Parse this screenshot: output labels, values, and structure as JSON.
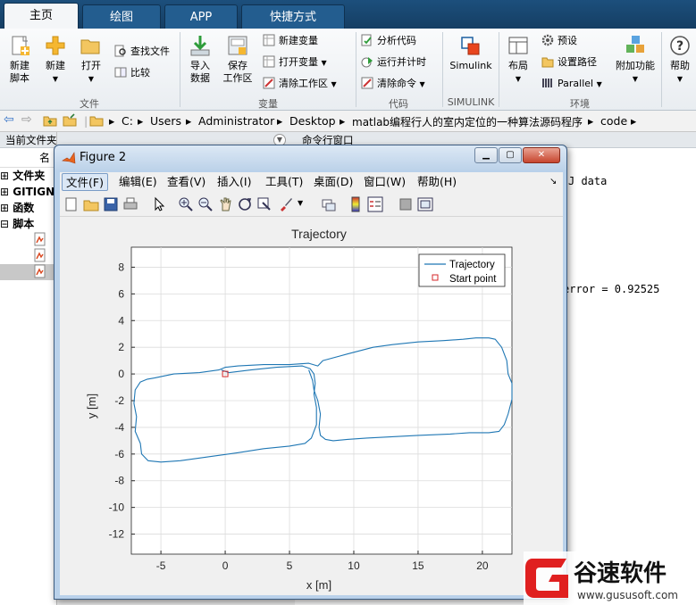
{
  "tabs": [
    {
      "label": "主页",
      "active": true
    },
    {
      "label": "绘图",
      "active": false
    },
    {
      "label": "APP",
      "active": false
    },
    {
      "label": "快捷方式",
      "active": false
    }
  ],
  "ribbon": {
    "file": {
      "new_script": "新建\n脚本",
      "new": "新建",
      "open": "打开",
      "find_files": "查找文件",
      "compare": "比较",
      "group": "文件"
    },
    "variable": {
      "import_data": "导入\n数据",
      "save_workspace": "保存\n工作区",
      "new_variable": "新建变量",
      "open_variable": "打开变量",
      "clear_workspace": "清除工作区",
      "group": "变量"
    },
    "code": {
      "analyze_code": "分析代码",
      "run_and_time": "运行并计时",
      "clear_commands": "清除命令",
      "group": "代码"
    },
    "simulink": {
      "label": "Simulink",
      "group": "SIMULINK"
    },
    "environment": {
      "layout": "布局",
      "preferences": "预设",
      "set_path": "设置路径",
      "parallel": "Parallel",
      "addons": "附加功能",
      "group": "环境"
    },
    "help": {
      "label": "帮助"
    }
  },
  "address": {
    "path": [
      "C:",
      "Users",
      "Administrator",
      "Desktop",
      "matlab编程行人的室内定位的一种算法源码程序",
      "code"
    ]
  },
  "left_panel": {
    "header": "当前文件夹",
    "col_name": "名",
    "items": [
      "文件夹",
      "GITIGN",
      "函数",
      "脚本"
    ]
  },
  "command_window": {
    "header": "命令行窗口",
    "lines": [
      "J data",
      "error = 0.92525"
    ]
  },
  "figure": {
    "title": "Figure 2",
    "menu": [
      "文件(F)",
      "编辑(E)",
      "查看(V)",
      "插入(I)",
      "工具(T)",
      "桌面(D)",
      "窗口(W)",
      "帮助(H)"
    ],
    "toolbar_icons": [
      "new-figure-icon",
      "open-file-icon",
      "save-icon",
      "print-icon",
      "pointer-icon",
      "zoom-in-icon",
      "zoom-out-icon",
      "pan-icon",
      "rotate-icon",
      "data-cursor-icon",
      "brush-icon",
      "link-icon",
      "colorbar-icon",
      "legend-icon",
      "hide-plot-tools-icon",
      "show-plot-tools-icon"
    ]
  },
  "chart_data": {
    "type": "line",
    "title": "Trajectory",
    "xlabel": "x [m]",
    "ylabel": "y [m]",
    "xlim": [
      -7.3,
      22.3
    ],
    "ylim": [
      -13.5,
      9.5
    ],
    "xticks": [
      -5,
      0,
      5,
      10,
      15,
      20
    ],
    "yticks": [
      -12,
      -10,
      -8,
      -6,
      -4,
      -2,
      0,
      2,
      4,
      6,
      8
    ],
    "grid": true,
    "legend": {
      "position": "top-right",
      "entries": [
        "Trajectory",
        "Start point"
      ]
    },
    "series": [
      {
        "name": "Trajectory",
        "color": "#1f77b4",
        "x": [
          -0.3,
          0.3,
          2,
          4,
          6,
          6.6,
          6.9,
          7.0,
          6.9,
          7.1,
          7.1,
          6.7,
          6.2,
          5,
          3,
          1,
          -0.5,
          -2,
          -3.5,
          -5,
          -6,
          -6.5,
          -6.6,
          -7.0,
          -6.9,
          -7.1,
          -7.0,
          -6.6,
          -6.1,
          -5.5,
          -4,
          -2,
          -0.5,
          0,
          1,
          3,
          5,
          6.5,
          7.2,
          7.6,
          9.5,
          11.5,
          13,
          15,
          17,
          18.5,
          19.5,
          20.5,
          21,
          21.5,
          21.9,
          22.0,
          22.3,
          22.3,
          22.0,
          21.7,
          21.3,
          20.5,
          19,
          17.5,
          15,
          13,
          11,
          9.5,
          8.4,
          7.8,
          7.4,
          7.3,
          7.4,
          7.2,
          6.9,
          6.8,
          6.5
        ],
        "y": [
          0.3,
          0.1,
          0.3,
          0.5,
          0.6,
          0.4,
          0.0,
          -0.7,
          -1.5,
          -2.5,
          -3.8,
          -4.8,
          -5.2,
          -5.4,
          -5.6,
          -5.9,
          -6.1,
          -6.3,
          -6.5,
          -6.6,
          -6.5,
          -6.0,
          -5.2,
          -4.3,
          -3.2,
          -2.2,
          -1.2,
          -0.6,
          -0.4,
          -0.3,
          0,
          0.1,
          0.3,
          0.5,
          0.6,
          0.7,
          0.7,
          0.8,
          0.6,
          1.0,
          1.5,
          2.0,
          2.2,
          2.4,
          2.5,
          2.6,
          2.7,
          2.7,
          2.6,
          2.0,
          1.0,
          0.0,
          -0.7,
          -1.9,
          -3.0,
          -3.8,
          -4.3,
          -4.4,
          -4.4,
          -4.5,
          -4.6,
          -4.7,
          -4.8,
          -4.9,
          -5.0,
          -4.9,
          -4.6,
          -4.0,
          -3.0,
          -2.0,
          -1.2,
          -0.5,
          0.3
        ]
      },
      {
        "name": "Start point",
        "color": "#d62728",
        "marker": "square",
        "x": [
          0
        ],
        "y": [
          0
        ]
      }
    ]
  },
  "watermark": {
    "brand": "谷速软件",
    "url": "www.gususoft.com"
  }
}
